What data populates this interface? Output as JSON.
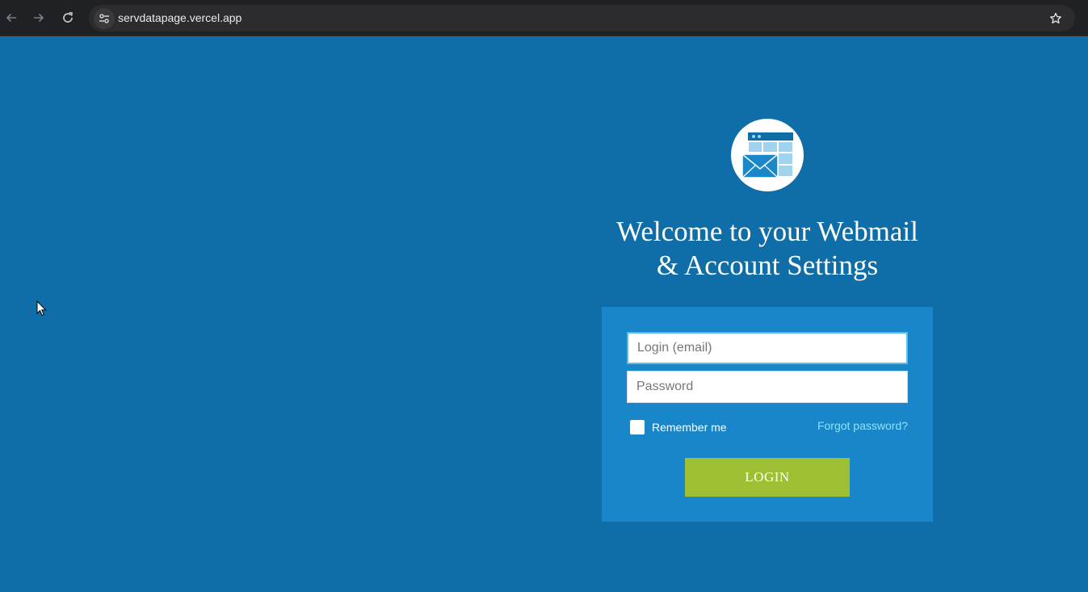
{
  "browser": {
    "url": "servdatapage.vercel.app",
    "icons": {
      "back": "arrow-left-icon",
      "forward": "arrow-right-icon",
      "reload": "reload-icon",
      "site_info": "tune-icon",
      "bookmark": "star-icon"
    }
  },
  "page": {
    "logo_icon": "webmail-envelope-icon",
    "heading_line1": "Welcome to your Webmail",
    "heading_line2": "& Account Settings",
    "login_form": {
      "email_placeholder": "Login (email)",
      "password_placeholder": "Password",
      "remember_label": "Remember me",
      "forgot_label": "Forgot password?",
      "submit_label": "LOGIN"
    }
  },
  "colors": {
    "page_background": "#0f6ea8",
    "panel_background": "#1886c8",
    "button": "#9cbf34",
    "link": "#8fe3f7"
  }
}
